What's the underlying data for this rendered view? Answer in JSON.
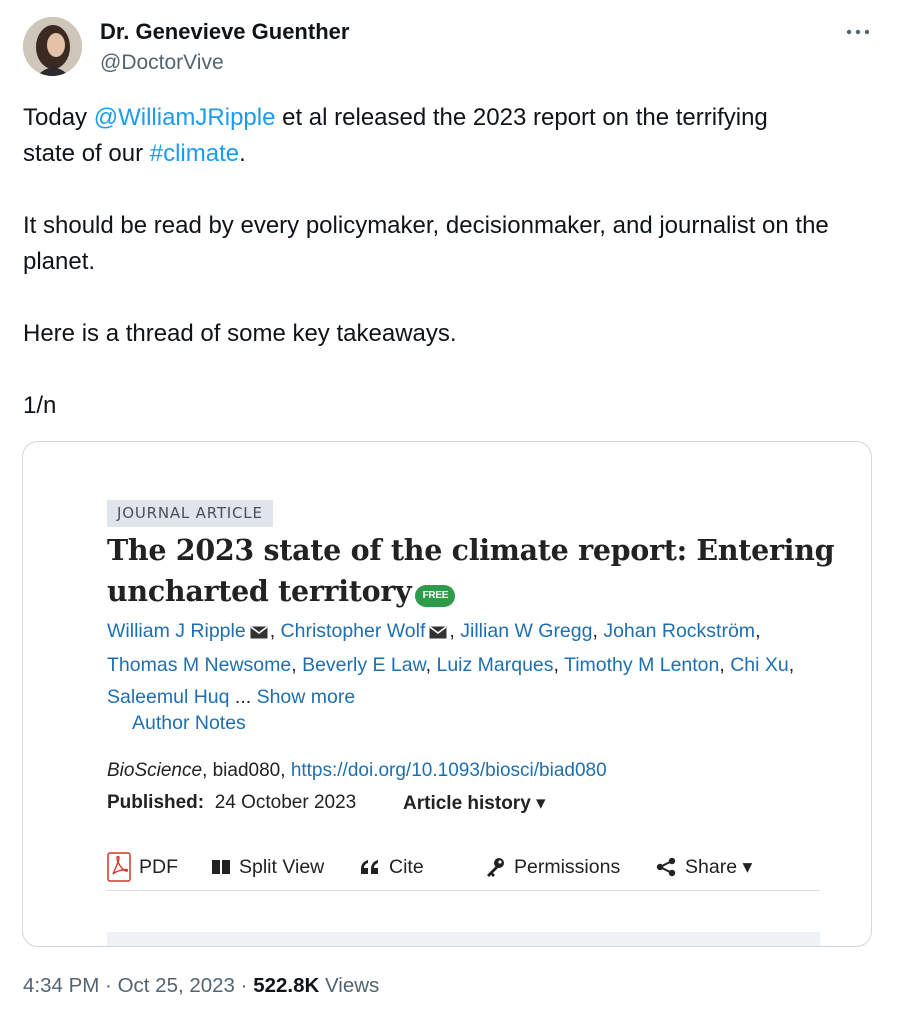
{
  "author": {
    "name": "Dr. Genevieve Guenther",
    "handle": "@DoctorVive"
  },
  "tweet": {
    "line1_pre": "Today ",
    "line1_mention": "@WilliamJRipple",
    "line1_post": " et al released the 2023 report on the terrifying",
    "line2_pre": "state of our ",
    "line2_hashtag": "#climate",
    "line2_post": ".",
    "para2": "It should be read by every policymaker, decisionmaker, and journalist on the planet.",
    "para3": "Here is a thread of some key takeaways.",
    "para4": "1/n"
  },
  "card": {
    "badge": "JOURNAL ARTICLE",
    "title_line1": "The 2023 state of the climate report: Entering",
    "title_line2": "uncharted territory",
    "free_label": "FREE",
    "authors": [
      "William J Ripple",
      "Christopher Wolf",
      "Jillian W Gregg",
      "Johan Rockström",
      "Thomas M Newsome",
      "Beverly E Law",
      "Luiz Marques",
      "Timothy M Lenton",
      "Chi Xu",
      "Saleemul Huq"
    ],
    "sep": ",",
    "ellipsis": " ... ",
    "show_more": "Show more",
    "author_notes": "Author Notes",
    "journal": "BioScience",
    "article_id": ", biad080, ",
    "doi": "https://doi.org/10.1093/biosci/biad080",
    "published_label": "Published:",
    "published_date": "24 October 2023",
    "article_history": "Article history ▾",
    "tools": {
      "pdf": "PDF",
      "split_view": "Split View",
      "cite": "Cite",
      "permissions": "Permissions",
      "share": "Share ▾"
    }
  },
  "meta": {
    "time": "4:34 PM",
    "dot": " · ",
    "date": "Oct 25, 2023",
    "views_count": "522.8K",
    "views_label": " Views"
  },
  "icons": {
    "more": "more-horizontal-icon",
    "mail": "envelope-icon",
    "pdf": "pdf-icon",
    "split": "split-view-icon",
    "cite": "quote-icon",
    "permissions": "key-icon",
    "share": "share-icon"
  },
  "colors": {
    "link": "#1d9bf0",
    "card_link": "#1f6fb0",
    "free_badge": "#2e9b4b",
    "muted": "#536471"
  }
}
